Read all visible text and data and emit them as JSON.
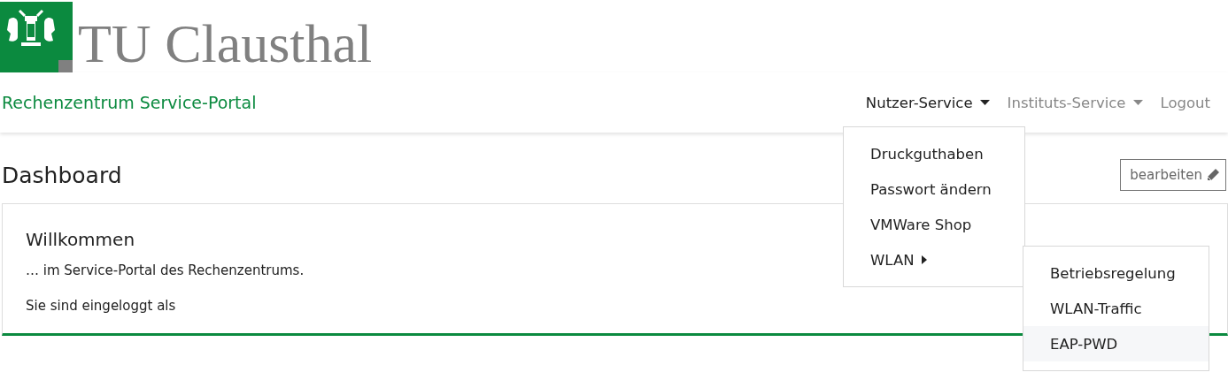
{
  "logo": {
    "text": "TU Clausthal"
  },
  "navbar": {
    "brand": "Rechenzentrum Service-Portal",
    "items": [
      {
        "label": "Nutzer-Service",
        "kind": "dropdown",
        "expanded": true
      },
      {
        "label": "Instituts-Service",
        "kind": "dropdown",
        "expanded": false
      },
      {
        "label": "Logout",
        "kind": "link"
      }
    ]
  },
  "dropdown": {
    "items": [
      {
        "label": "Druckguthaben",
        "kind": "item"
      },
      {
        "label": "Passwort ändern",
        "kind": "item"
      },
      {
        "label": "VMWare Shop",
        "kind": "item"
      },
      {
        "label": "WLAN",
        "kind": "submenu",
        "expanded": true
      }
    ]
  },
  "submenu": {
    "items": [
      {
        "label": "Betriebsregelung",
        "selected": false
      },
      {
        "label": "WLAN-Traffic",
        "selected": false
      },
      {
        "label": "EAP-PWD",
        "selected": true
      }
    ]
  },
  "page": {
    "title": "Dashboard",
    "edit_button": "bearbeiten"
  },
  "card": {
    "title": "Willkommen",
    "lines": [
      "… im Service-Portal des Rechenzentrums.",
      "Sie sind eingeloggt als"
    ]
  }
}
